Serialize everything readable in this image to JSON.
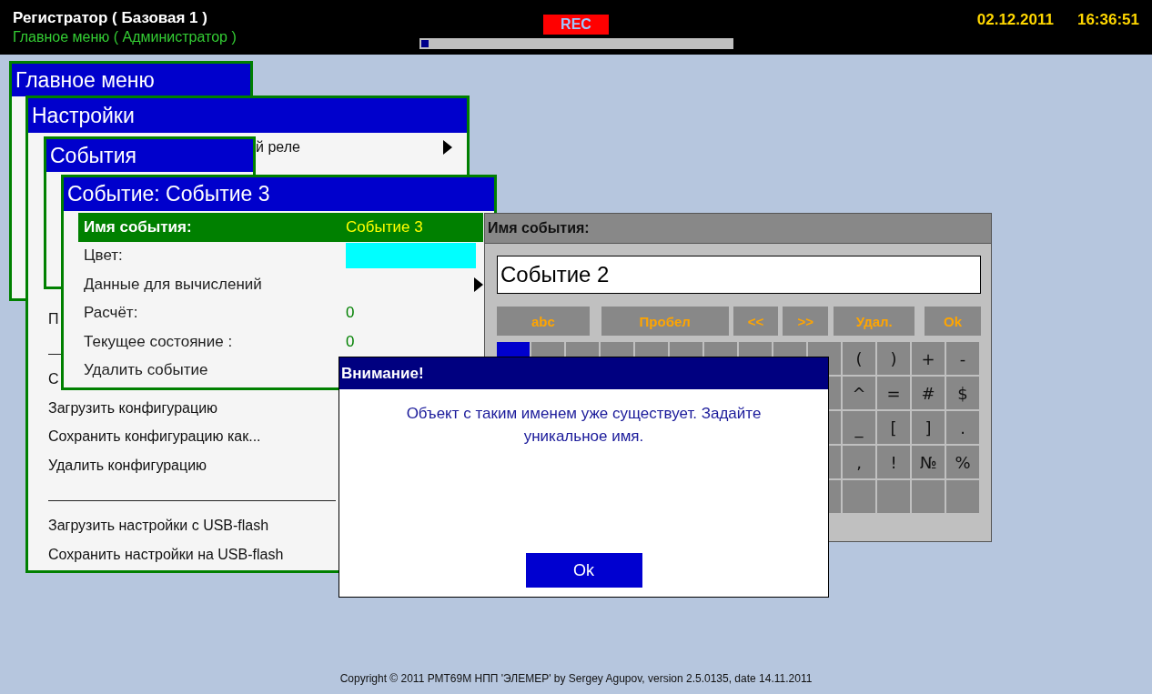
{
  "header": {
    "title": "Регистратор ( Базовая 1 )",
    "subtitle": "Главное меню ( Администратор )",
    "rec": "REC",
    "progress": {
      "level": 0.03
    },
    "date": "02.12.2011",
    "time": "16:36:51"
  },
  "main_menu": {
    "title": "Главное меню"
  },
  "settings": {
    "title": "Настройки",
    "items": [
      {
        "kind": "submenu",
        "text": "й реле"
      },
      {
        "kind": "action",
        "text": "П"
      },
      {
        "kind": "separator"
      },
      {
        "kind": "action",
        "text": "С"
      },
      {
        "kind": "action",
        "text": "Загрузить конфигурацию"
      },
      {
        "kind": "action",
        "text": "Сохранить конфигурацию как..."
      },
      {
        "kind": "action",
        "text": "Удалить конфигурацию"
      },
      {
        "kind": "separator"
      },
      {
        "kind": "action",
        "text": "Загрузить настройки с USB-flash"
      },
      {
        "kind": "action",
        "text": "Сохранить настройки на USB-flash"
      }
    ]
  },
  "events": {
    "title": "События"
  },
  "event": {
    "title": "Событие: Событие 3",
    "rows": [
      {
        "kind": "text",
        "label": "Имя события:",
        "value": "Событие 3",
        "selected": true
      },
      {
        "kind": "color",
        "label": "Цвет:",
        "color": "#00ffff",
        "selected": false
      },
      {
        "kind": "submenu",
        "label": "Данные для вычислений",
        "selected": false
      },
      {
        "kind": "text",
        "label": "Расчёт:",
        "value": "0",
        "selected": false
      },
      {
        "kind": "text",
        "label": "Текущее состояние :",
        "value": "0",
        "selected": false
      },
      {
        "kind": "action",
        "label": "Удалить событие",
        "selected": false
      }
    ]
  },
  "keyboard": {
    "title": "Имя события:",
    "value": "Событие 2",
    "function_keys": [
      "abc",
      "Пробел",
      "<<",
      ">>",
      "Удал.",
      "Ok"
    ],
    "keys": [
      [
        {
          "selected": true
        },
        {
          "selected": false
        },
        {
          "selected": false
        },
        {
          "selected": false
        },
        {
          "selected": false
        },
        {
          "selected": false
        },
        {
          "selected": false
        },
        {
          "selected": false
        },
        {
          "selected": false
        },
        {
          "selected": false
        },
        {
          "label": "(",
          "selected": false
        },
        {
          "label": ")",
          "selected": false
        },
        {
          "label": "+",
          "selected": false
        },
        {
          "label": "-",
          "selected": false
        }
      ],
      [
        {
          "selected": false
        },
        {
          "label": "^",
          "selected": false
        },
        {
          "label": "=",
          "selected": false
        },
        {
          "label": "#",
          "selected": false
        },
        {
          "label": "$",
          "selected": false
        }
      ],
      [
        {
          "selected": false
        },
        {
          "label": "_",
          "selected": false
        },
        {
          "label": "[",
          "selected": false
        },
        {
          "label": "]",
          "selected": false
        },
        {
          "label": ".",
          "selected": false
        }
      ],
      [
        {
          "selected": false
        },
        {
          "label": ",",
          "selected": false
        },
        {
          "label": "!",
          "selected": false
        },
        {
          "label": "№",
          "selected": false
        },
        {
          "label": "%",
          "selected": false
        }
      ],
      [
        {
          "selected": false
        },
        {
          "selected": false
        },
        {
          "selected": false
        },
        {
          "selected": false
        },
        {
          "selected": false
        }
      ]
    ]
  },
  "dialog": {
    "title": "Внимание!",
    "message": "Объект с таким именем уже существует. Задайте уникальное имя.",
    "button": "Ok"
  },
  "footer": "Copyright © 2011 РМТ69М НПП 'ЭЛЕМЕР' by Sergey Agupov, version 2.5.0135, date 14.11.2011"
}
